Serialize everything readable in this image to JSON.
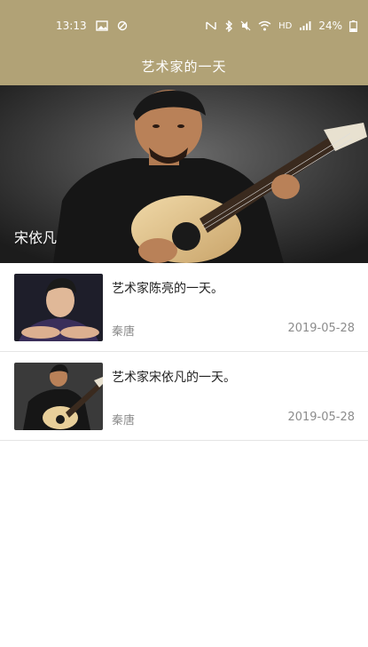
{
  "status_bar": {
    "time": "13:13",
    "battery": "24%",
    "network": "HD",
    "signal_icons": [
      "image-icon",
      "notification-icon",
      "nfc-icon",
      "bluetooth-icon",
      "mute-icon",
      "wifi-icon",
      "signal-icon",
      "battery-icon"
    ]
  },
  "header": {
    "title": "艺术家的一天",
    "background_color": "#b1a276"
  },
  "hero": {
    "caption": "宋依凡"
  },
  "articles": [
    {
      "title": "艺术家陈亮的一天。",
      "author": "秦唐",
      "date": "2019-05-28"
    },
    {
      "title": "艺术家宋依凡的一天。",
      "author": "秦唐",
      "date": "2019-05-28"
    }
  ]
}
